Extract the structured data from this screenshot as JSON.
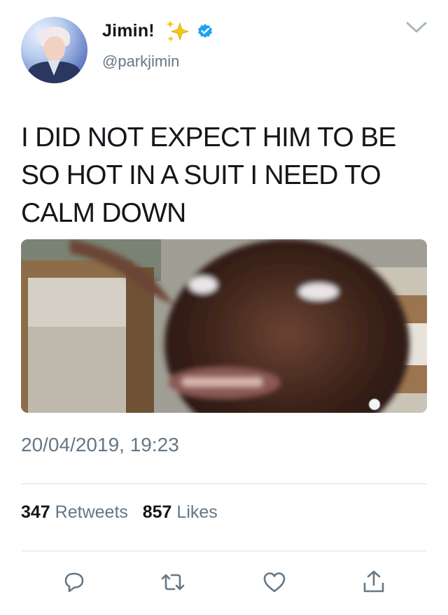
{
  "user": {
    "name": "Jimin!",
    "handle": "@parkjimin"
  },
  "tweet": {
    "text": "I DID NOT EXPECT HIM TO BE SO HOT IN A SUIT I NEED TO CALM DOWN",
    "timestamp": "20/04/2019, 19:23"
  },
  "stats": {
    "retweets_count": "347",
    "retweets_label": "Retweets",
    "likes_count": "857",
    "likes_label": "Likes"
  },
  "icons": {
    "sparkle": "sparkles-icon",
    "verified": "verified-badge-icon",
    "menu": "chevron-down-icon",
    "reply": "reply-icon",
    "retweet": "retweet-icon",
    "like": "heart-icon",
    "share": "share-icon"
  },
  "colors": {
    "text": "#14171a",
    "secondary": "#657786",
    "verified": "#1da1f2",
    "sparkle": "#f5c518",
    "divider": "#d8dee3"
  }
}
